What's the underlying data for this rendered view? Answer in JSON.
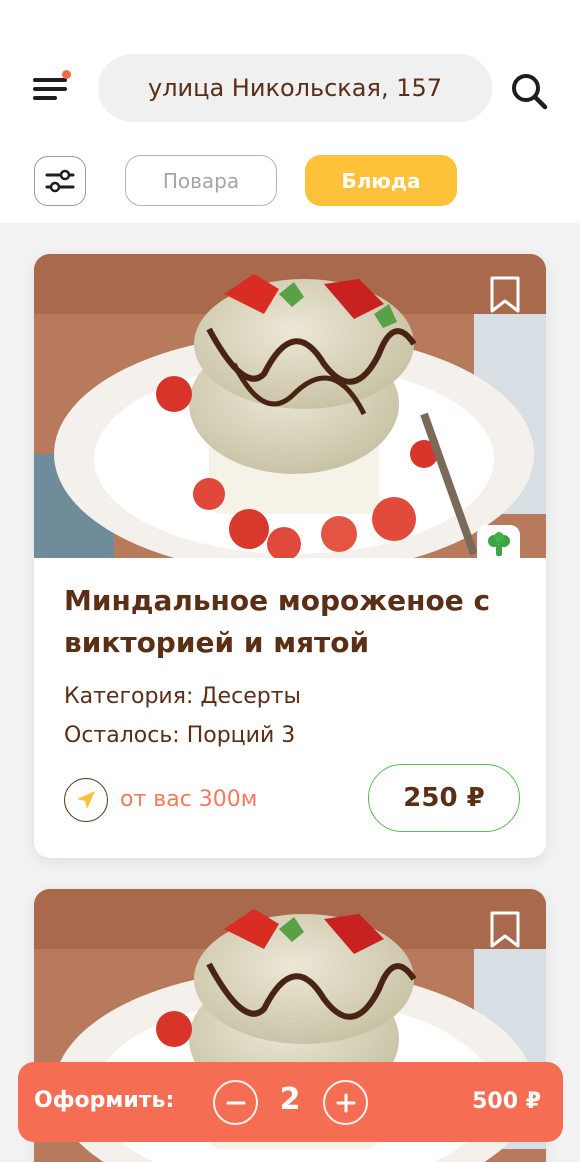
{
  "header": {
    "address": "улица Никольская, 157",
    "has_notification": true
  },
  "tabs": [
    {
      "label": "Повара",
      "active": false
    },
    {
      "label": "Блюда",
      "active": true
    }
  ],
  "cards": [
    {
      "title": "Миндальное мороженое с викторией и мятой",
      "category": "Категория: Десерты",
      "portions_left": "Осталось: Порций 3",
      "distance": "от вас 300м",
      "price": "250 ₽",
      "badge_icon": "broccoli-icon"
    },
    {
      "title": "",
      "badge_icon": "bookmark-icon"
    }
  ],
  "order": {
    "label": "Оформить:",
    "quantity": "2",
    "total": "500 ₽"
  },
  "colors": {
    "accent_yellow": "#fdc13a",
    "accent_orange": "#f56e53",
    "price_border_green": "#52c14e",
    "text_brown": "#5b2e16",
    "distance_orange": "#f47a5a"
  }
}
